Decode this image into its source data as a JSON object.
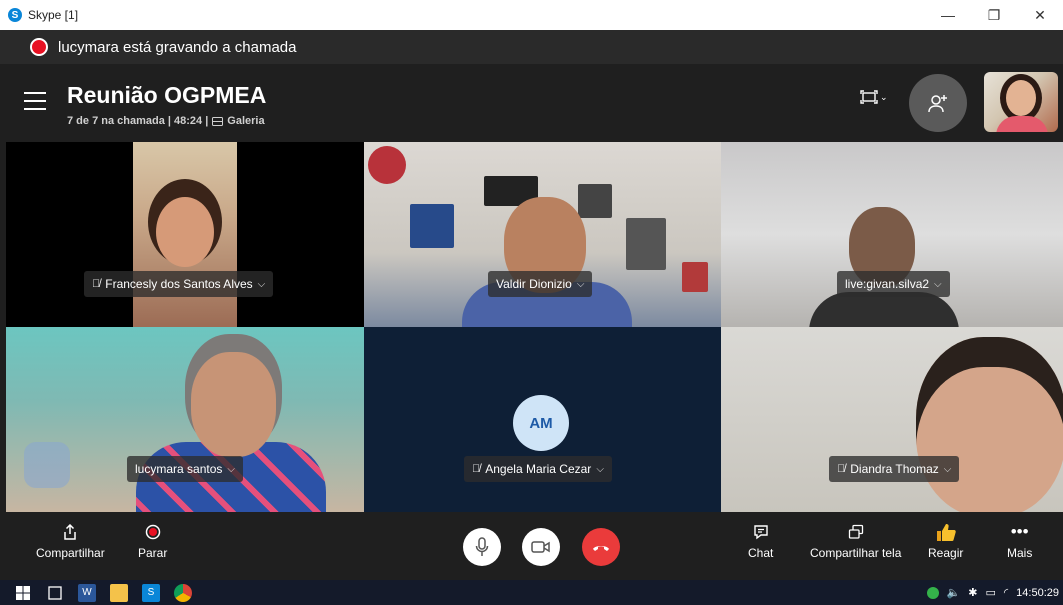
{
  "window": {
    "title": "Skype [1]",
    "logo": "S",
    "minimize": "—",
    "restore": "❐",
    "close": "✕"
  },
  "recording": {
    "text": "lucymara está gravando a chamada"
  },
  "meeting": {
    "title": "Reunião OGPMEA",
    "status": "7 de 7 na chamada | 48:24 |",
    "view_mode": "Galeria"
  },
  "participants": [
    {
      "name": "Francesly dos Santos Alves",
      "muted": true
    },
    {
      "name": "Valdir Dionizio",
      "muted": false
    },
    {
      "name": "live:givan.silva2",
      "muted": false
    },
    {
      "name": "lucymara santos",
      "muted": false
    },
    {
      "name": "Angela Maria Cezar",
      "muted": true,
      "initials": "AM"
    },
    {
      "name": "Diandra Thomaz",
      "muted": true
    }
  ],
  "toolbar": {
    "share": "Compartilhar",
    "stop": "Parar",
    "chat": "Chat",
    "share_screen": "Compartilhar tela",
    "react": "Reagir",
    "more": "Mais"
  },
  "taskbar": {
    "time": "14:50:29"
  },
  "colors": {
    "accent": "#0a86d8",
    "end_call": "#ea3b3b",
    "record": "#e81123"
  }
}
